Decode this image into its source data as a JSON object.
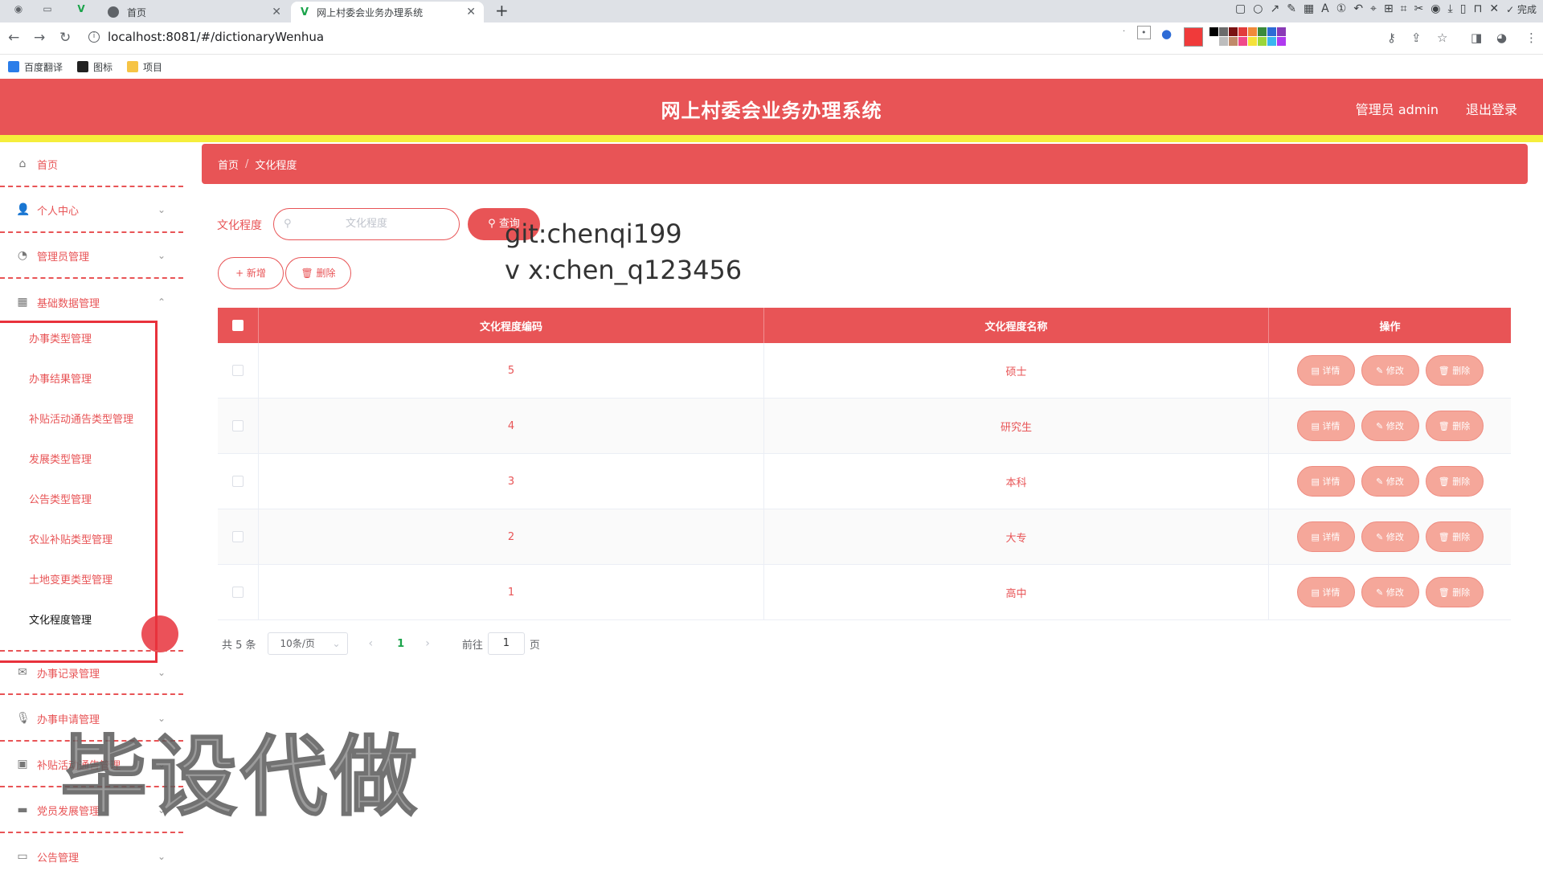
{
  "browser": {
    "tabs": [
      {
        "label": "首页",
        "active": false
      },
      {
        "label": "网上村委会业务办理系统",
        "active": true
      }
    ],
    "url": "localhost:8081/#/dictionaryWenhua",
    "done_label": "完成",
    "bookmarks": [
      {
        "label": "百度翻译",
        "color": "#2b7de9"
      },
      {
        "label": "图标",
        "color": "#222222"
      },
      {
        "label": "项目",
        "color": "#f6c445"
      }
    ],
    "palette": [
      "#000000",
      "#6b6b6b",
      "#7a1212",
      "#e23b3b",
      "#f08a3a",
      "#3a8a3a",
      "#2d6bd6",
      "#8a3ab6",
      "#ffffff",
      "#bdbdbd",
      "#c08a6a",
      "#f04a8a",
      "#f5e23a",
      "#9ad63a",
      "#3ab6f0",
      "#b03af0"
    ]
  },
  "header": {
    "title": "网上村委会业务办理系统",
    "user": "管理员 admin",
    "logout": "退出登录"
  },
  "sidebar": {
    "items": [
      {
        "label": "首页",
        "icon": "home-icon"
      },
      {
        "label": "个人中心",
        "icon": "user-icon"
      },
      {
        "label": "管理员管理",
        "icon": "gauge-icon"
      },
      {
        "label": "基础数据管理",
        "icon": "grid-icon"
      }
    ],
    "sub_items": [
      "办事类型管理",
      "办事结果管理",
      "补贴活动通告类型管理",
      "发展类型管理",
      "公告类型管理",
      "农业补贴类型管理",
      "土地变更类型管理",
      "文化程度管理"
    ],
    "lower_items": [
      {
        "label": "办事记录管理",
        "icon": "mail-icon"
      },
      {
        "label": "办事申请管理",
        "icon": "mic-icon"
      },
      {
        "label": "补贴活动通告管理",
        "icon": "clipboard-icon"
      },
      {
        "label": "党员发展管理",
        "icon": "monitor-icon"
      },
      {
        "label": "公告管理",
        "icon": "chat-icon"
      }
    ]
  },
  "breadcrumb": {
    "home": "首页",
    "current": "文化程度"
  },
  "search": {
    "label": "文化程度",
    "placeholder": "文化程度",
    "button": "查询"
  },
  "actions": {
    "add": "+ 新增",
    "delete": "🗑 删除"
  },
  "overlay": {
    "line1": "git:chenqi199",
    "line2": "v x:chen_q123456"
  },
  "table": {
    "headers": [
      "文化程度编码",
      "文化程度名称",
      "操作"
    ],
    "rows": [
      {
        "code": "5",
        "name": "硕士"
      },
      {
        "code": "4",
        "name": "研究生"
      },
      {
        "code": "3",
        "name": "本科"
      },
      {
        "code": "2",
        "name": "大专"
      },
      {
        "code": "1",
        "name": "高中"
      }
    ],
    "row_actions": [
      "详情",
      "修改",
      "删除"
    ]
  },
  "pagination": {
    "total": "共 5 条",
    "page_size": "10条/页",
    "current_page": "1",
    "goto_label": "前往",
    "goto_value": "1",
    "page_suffix": "页"
  },
  "watermark": "毕设代做"
}
